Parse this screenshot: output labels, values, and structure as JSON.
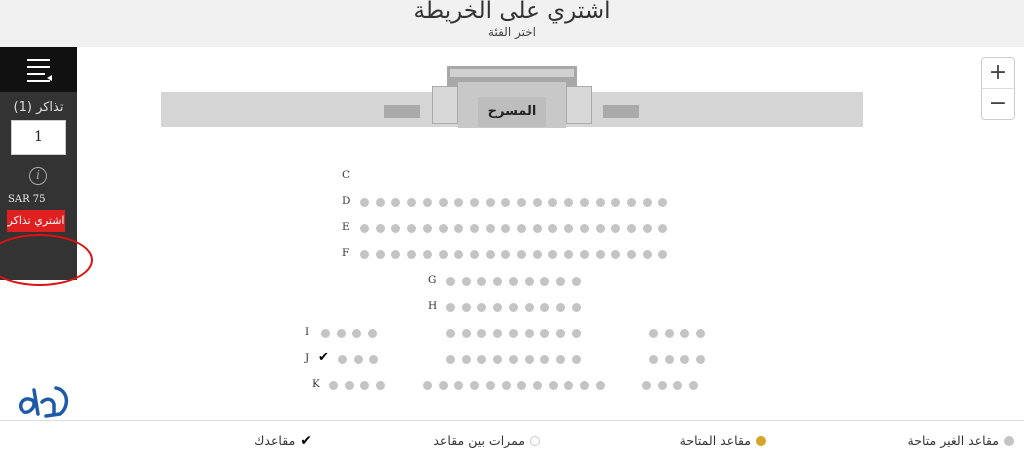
{
  "header": {
    "title": "اشتري على الخريطة",
    "subtitle": "اختر الفئة"
  },
  "sidebar": {
    "menu_icon": "menu-icon",
    "tickets_label": "تذاكر (1)",
    "quantity": "1",
    "info_icon": "info-icon",
    "info_glyph": "i",
    "price": "SAR 75",
    "buy_label": "اشتري تذاكر"
  },
  "zoom": {
    "in_label": "+",
    "out_label": "−"
  },
  "stage": {
    "label": "المسرح"
  },
  "seat_map": {
    "rows": [
      {
        "label": "C",
        "blocks": []
      },
      {
        "label": "D",
        "blocks": [
          20
        ]
      },
      {
        "label": "E",
        "blocks": [
          20
        ]
      },
      {
        "label": "F",
        "blocks": [
          20
        ]
      },
      {
        "label": "G",
        "blocks": [
          9
        ]
      },
      {
        "label": "H",
        "blocks": [
          9
        ]
      },
      {
        "label": "I",
        "blocks": [
          4,
          9,
          4
        ]
      },
      {
        "label": "J",
        "blocks": [
          3,
          9,
          4
        ],
        "selected": "✔"
      },
      {
        "label": "K",
        "blocks": [
          4,
          12,
          4
        ]
      }
    ]
  },
  "legend": {
    "unavailable": "مقاعد الغير متاحة",
    "available": "مقاعد المتاحة",
    "aisles": "ممرات بين مقاعد",
    "your_seats": "مقاعدك",
    "check_glyph": "✔",
    "colors": {
      "unavailable": "#c4c4c4",
      "available": "#d4a52a",
      "aisle": "#ffffff"
    }
  },
  "colors": {
    "buy_button": "#e02020",
    "sidebar": "#333333",
    "header_bg": "#f1f1f1"
  }
}
